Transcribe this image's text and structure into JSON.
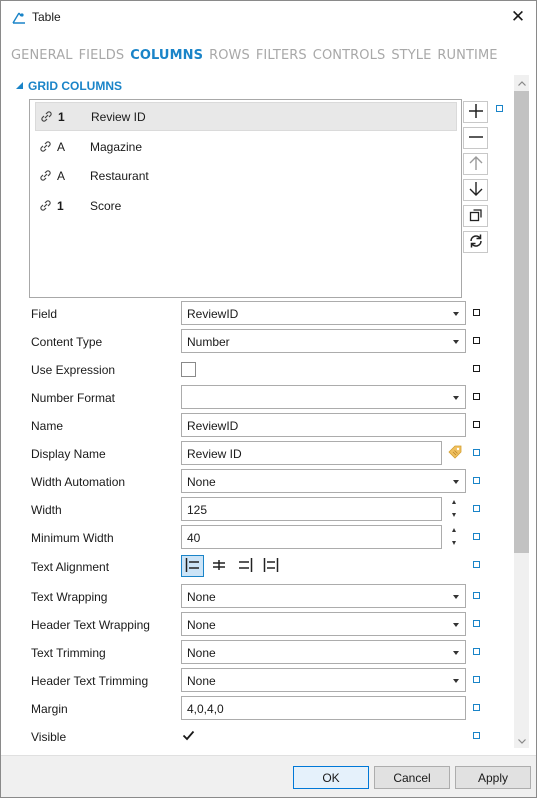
{
  "window": {
    "title": "Table",
    "close_glyph": "✕"
  },
  "tabs": [
    {
      "label": "GENERAL",
      "active": false
    },
    {
      "label": "FIELDS",
      "active": false
    },
    {
      "label": "COLUMNS",
      "active": true
    },
    {
      "label": "ROWS",
      "active": false
    },
    {
      "label": "FILTERS",
      "active": false
    },
    {
      "label": "CONTROLS",
      "active": false
    },
    {
      "label": "STYLE",
      "active": false
    },
    {
      "label": "RUNTIME",
      "active": false
    }
  ],
  "section": {
    "title": "GRID COLUMNS"
  },
  "columns": [
    {
      "type_glyph": "1",
      "name": "Review ID",
      "selected": true
    },
    {
      "type_glyph": "A",
      "name": "Magazine",
      "selected": false
    },
    {
      "type_glyph": "A",
      "name": "Restaurant",
      "selected": false
    },
    {
      "type_glyph": "1",
      "name": "Score",
      "selected": false
    }
  ],
  "column_buttons": [
    "add-icon",
    "remove-icon",
    "move-up-icon",
    "move-down-icon",
    "duplicate-icon",
    "refresh-icon"
  ],
  "properties": {
    "field": {
      "label": "Field",
      "value": "ReviewID"
    },
    "content_type": {
      "label": "Content Type",
      "value": "Number"
    },
    "use_expression": {
      "label": "Use Expression",
      "checked": false
    },
    "number_format": {
      "label": "Number Format",
      "value": ""
    },
    "name": {
      "label": "Name",
      "value": "ReviewID"
    },
    "display_name": {
      "label": "Display Name",
      "value": "Review ID"
    },
    "width_automation": {
      "label": "Width Automation",
      "value": "None"
    },
    "width": {
      "label": "Width",
      "value": "125"
    },
    "minimum_width": {
      "label": "Minimum Width",
      "value": "40"
    },
    "text_alignment": {
      "label": "Text Alignment",
      "selected": "left"
    },
    "text_wrapping": {
      "label": "Text Wrapping",
      "value": "None"
    },
    "header_text_wrapping": {
      "label": "Header Text Wrapping",
      "value": "None"
    },
    "text_trimming": {
      "label": "Text Trimming",
      "value": "None"
    },
    "header_text_trimming": {
      "label": "Header Text Trimming",
      "value": "None"
    },
    "margin": {
      "label": "Margin",
      "value": "4,0,4,0"
    },
    "visible": {
      "label": "Visible",
      "checked": true
    }
  },
  "footer": {
    "ok_label": "OK",
    "cancel_label": "Cancel",
    "apply_label": "Apply"
  },
  "colors": {
    "accent": "#1a84c8",
    "inactive_tab": "#a8a8a8",
    "selected_row": "#e8e8e8"
  }
}
